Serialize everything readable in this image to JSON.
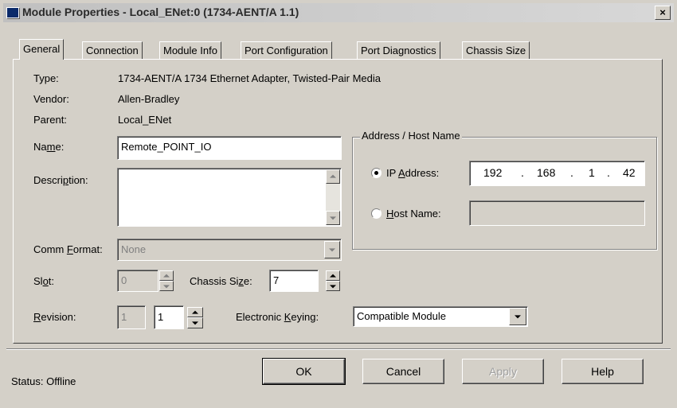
{
  "window": {
    "title": "Module Properties - Local_ENet:0 (1734-AENT/A 1.1)",
    "close_glyph": "×"
  },
  "tabs": [
    {
      "label": "General",
      "active": true
    },
    {
      "label": "Connection",
      "active": false
    },
    {
      "label": "Module Info",
      "active": false
    },
    {
      "label": "Port Configuration",
      "active": false
    },
    {
      "label": "Port Diagnostics",
      "active": false
    },
    {
      "label": "Chassis Size",
      "active": false
    }
  ],
  "general": {
    "type_label": "Type:",
    "type_value": "1734-AENT/A 1734 Ethernet Adapter, Twisted-Pair Media",
    "vendor_label": "Vendor:",
    "vendor_value": "Allen-Bradley",
    "parent_label": "Parent:",
    "parent_value": "Local_ENet",
    "name_label_pre": "Na",
    "name_label_u": "m",
    "name_label_post": "e:",
    "name_value": "Remote_POINT_IO",
    "description_label_pre": "Descri",
    "description_label_u": "p",
    "description_label_post": "tion:",
    "description_value": "",
    "comm_format_label_pre": "Comm ",
    "comm_format_label_u": "F",
    "comm_format_label_post": "ormat:",
    "comm_format_value": "None",
    "slot_label_pre": "Sl",
    "slot_label_u": "o",
    "slot_label_post": "t:",
    "slot_value": "0",
    "chassis_size_label_pre": "Chassis Si",
    "chassis_size_label_u": "z",
    "chassis_size_label_post": "e:",
    "chassis_size_value": "7",
    "revision_label_pre": "",
    "revision_label_u": "R",
    "revision_label_post": "evision:",
    "revision_major": "1",
    "revision_minor": "1",
    "keying_label_pre": "Electronic ",
    "keying_label_u": "K",
    "keying_label_post": "eying:",
    "keying_value": "Compatible Module"
  },
  "address": {
    "group_title": "Address / Host Name",
    "ip_label_pre": "IP ",
    "ip_label_u": "A",
    "ip_label_post": "ddress:",
    "ip_selected": true,
    "ip_octets": [
      "192",
      "168",
      "1",
      "42"
    ],
    "ip_dot": ".",
    "host_label_pre": "",
    "host_label_u": "H",
    "host_label_post": "ost Name:",
    "host_value": ""
  },
  "footer": {
    "status": "Status:  Offline",
    "ok_label": "OK",
    "cancel_label": "Cancel",
    "apply_label": "Apply",
    "help_label": "Help"
  }
}
